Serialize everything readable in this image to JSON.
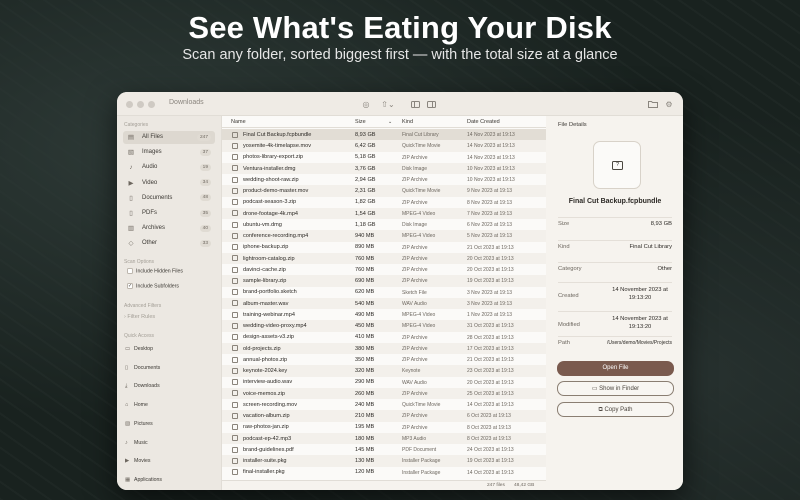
{
  "hero": {
    "title": "See What's Eating Your Disk",
    "subtitle": "Scan any folder, sorted biggest first — with the total size at a glance"
  },
  "window": {
    "title": "Downloads",
    "toolbar_icons": [
      "scan-icon",
      "share-icon",
      "sidebar-left-icon",
      "sidebar-right-icon",
      "folder-open-icon",
      "gear-icon"
    ]
  },
  "sidebar": {
    "categories_label": "Categories",
    "categories": [
      {
        "label": "All Files",
        "count": "247",
        "icon": "files-icon"
      },
      {
        "label": "Images",
        "count": "37",
        "icon": "image-icon"
      },
      {
        "label": "Audio",
        "count": "19",
        "icon": "music-note-icon"
      },
      {
        "label": "Video",
        "count": "34",
        "icon": "video-icon"
      },
      {
        "label": "Documents",
        "count": "48",
        "icon": "document-icon"
      },
      {
        "label": "PDFs",
        "count": "35",
        "icon": "pdf-icon"
      },
      {
        "label": "Archives",
        "count": "40",
        "icon": "archive-icon"
      },
      {
        "label": "Other",
        "count": "33",
        "icon": "other-icon"
      }
    ],
    "scan_options_label": "Scan Options",
    "options": [
      {
        "label": "Include Hidden Files",
        "checked": false
      },
      {
        "label": "Include Subfolders",
        "checked": true
      }
    ],
    "advanced_filters_label": "Advanced Filters",
    "filter_rules_label": "› Filter Rules",
    "quick_access_label": "Quick Access",
    "quick_access": [
      {
        "label": "Desktop",
        "icon": "desktop-icon"
      },
      {
        "label": "Documents",
        "icon": "document-icon"
      },
      {
        "label": "Downloads",
        "icon": "download-icon"
      },
      {
        "label": "Home",
        "icon": "home-icon"
      },
      {
        "label": "Pictures",
        "icon": "image-icon"
      },
      {
        "label": "Music",
        "icon": "music-note-icon"
      },
      {
        "label": "Movies",
        "icon": "video-icon"
      },
      {
        "label": "Applications",
        "icon": "apps-icon"
      }
    ]
  },
  "list": {
    "columns": {
      "name": "Name",
      "size": "Size",
      "kind": "Kind",
      "date": "Date Created"
    },
    "rows": [
      [
        "Final Cut Backup.fcpbundle",
        "8,93 GB",
        "Final Cut Library",
        "14 Nov 2023 at 19:13"
      ],
      [
        "yosemite-4k-timelapse.mov",
        "6,42 GB",
        "QuickTime Movie",
        "14 Nov 2023 at 19:13"
      ],
      [
        "photos-library-export.zip",
        "5,18 GB",
        "ZIP Archive",
        "14 Nov 2023 at 19:13"
      ],
      [
        "Ventura-installer.dmg",
        "3,76 GB",
        "Disk Image",
        "10 Nov 2023 at 19:13"
      ],
      [
        "wedding-shoot-raw.zip",
        "2,94 GB",
        "ZIP Archive",
        "10 Nov 2023 at 19:13"
      ],
      [
        "product-demo-master.mov",
        "2,31 GB",
        "QuickTime Movie",
        "9 Nov 2023 at 19:13"
      ],
      [
        "podcast-season-3.zip",
        "1,82 GB",
        "ZIP Archive",
        "8 Nov 2023 at 19:13"
      ],
      [
        "drone-footage-4k.mp4",
        "1,54 GB",
        "MPEG-4 Video",
        "7 Nov 2023 at 19:13"
      ],
      [
        "ubuntu-vm.dmg",
        "1,18 GB",
        "Disk Image",
        "6 Nov 2023 at 19:13"
      ],
      [
        "conference-recording.mp4",
        "940 MB",
        "MPEG-4 Video",
        "5 Nov 2023 at 19:13"
      ],
      [
        "iphone-backup.zip",
        "890 MB",
        "ZIP Archive",
        "21 Oct 2023 at 19:13"
      ],
      [
        "lightroom-catalog.zip",
        "760 MB",
        "ZIP Archive",
        "20 Oct 2023 at 19:13"
      ],
      [
        "davinci-cache.zip",
        "760 MB",
        "ZIP Archive",
        "20 Oct 2023 at 19:13"
      ],
      [
        "sample-library.zip",
        "690 MB",
        "ZIP Archive",
        "19 Oct 2023 at 19:13"
      ],
      [
        "brand-portfolio.sketch",
        "620 MB",
        "Sketch File",
        "3 Nov 2023 at 19:13"
      ],
      [
        "album-master.wav",
        "540 MB",
        "WAV Audio",
        "3 Nov 2023 at 19:13"
      ],
      [
        "training-webinar.mp4",
        "490 MB",
        "MPEG-4 Video",
        "1 Nov 2023 at 19:13"
      ],
      [
        "wedding-video-proxy.mp4",
        "450 MB",
        "MPEG-4 Video",
        "31 Oct 2023 at 19:13"
      ],
      [
        "design-assets-v3.zip",
        "410 MB",
        "ZIP Archive",
        "28 Oct 2023 at 19:13"
      ],
      [
        "old-projects.zip",
        "380 MB",
        "ZIP Archive",
        "17 Oct 2023 at 19:13"
      ],
      [
        "annual-photos.zip",
        "350 MB",
        "ZIP Archive",
        "21 Oct 2023 at 19:13"
      ],
      [
        "keynote-2024.key",
        "320 MB",
        "Keynote",
        "23 Oct 2023 at 19:13"
      ],
      [
        "interview-audio.wav",
        "290 MB",
        "WAV Audio",
        "20 Oct 2023 at 19:13"
      ],
      [
        "voice-memos.zip",
        "260 MB",
        "ZIP Archive",
        "25 Oct 2023 at 19:13"
      ],
      [
        "screen-recording.mov",
        "240 MB",
        "QuickTime Movie",
        "14 Oct 2023 at 19:13"
      ],
      [
        "vacation-album.zip",
        "210 MB",
        "ZIP Archive",
        "6 Oct 2023 at 19:13"
      ],
      [
        "raw-photos-jan.zip",
        "195 MB",
        "ZIP Archive",
        "8 Oct 2023 at 19:13"
      ],
      [
        "podcast-ep-42.mp3",
        "180 MB",
        "MP3 Audio",
        "8 Oct 2023 at 19:13"
      ],
      [
        "brand-guidelines.pdf",
        "145 MB",
        "PDF Document",
        "24 Oct 2023 at 19:13"
      ],
      [
        "installer-suite.pkg",
        "130 MB",
        "Installer Package",
        "19 Oct 2023 at 19:13"
      ],
      [
        "final-installer.pkg",
        "120 MB",
        "Installer Package",
        "14 Oct 2023 at 19:13"
      ]
    ],
    "footer_count": "247 files",
    "footer_total": "48,42 GB"
  },
  "details": {
    "header": "File Details",
    "file_name": "Final Cut Backup.fcpbundle",
    "fields": [
      {
        "label": "Size",
        "value": "8,93 GB"
      },
      {
        "label": "Kind",
        "value": "Final Cut Library"
      },
      {
        "label": "Category",
        "value": "Other"
      },
      {
        "label": "Created",
        "value": "14 November 2023 at 19:13:20"
      },
      {
        "label": "Modified",
        "value": "14 November 2023 at 19:13:20"
      },
      {
        "label": "Path",
        "value": "/Users/demo/Movies/Projects"
      }
    ],
    "buttons": {
      "open": "Open File",
      "finder": "Show in Finder",
      "copy": "Copy Path"
    }
  },
  "colors": {
    "accent": "#7a5a4e",
    "selection": "#e2ddd5",
    "sidebar": "#ece8e2"
  }
}
